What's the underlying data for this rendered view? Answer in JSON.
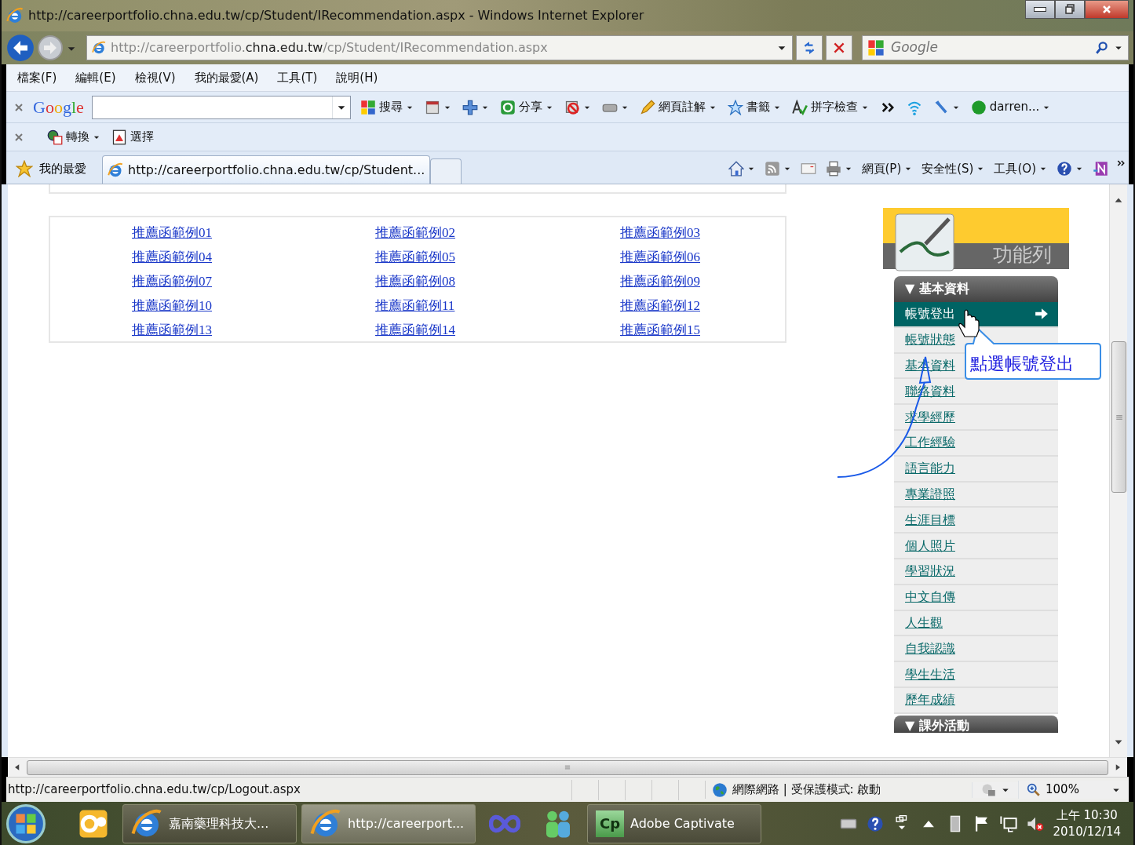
{
  "window": {
    "title": "http://careerportfolio.chna.edu.tw/cp/Student/IRecommendation.aspx - Windows Internet Explorer"
  },
  "address_bar": {
    "url_parts": [
      "http://careerportfolio.",
      "chna.edu.tw",
      "/cp/Student/IRecommendation.aspx"
    ],
    "search_placeholder": "Google"
  },
  "menu": [
    "檔案(F)",
    "編輯(E)",
    "檢視(V)",
    "我的最愛(A)",
    "工具(T)",
    "說明(H)"
  ],
  "google_toolbar": {
    "logo": "Google",
    "items": [
      {
        "kind": "gsearch",
        "label": "搜尋",
        "dropdown": true
      },
      {
        "kind": "page",
        "dropdown": true
      },
      {
        "kind": "plus",
        "dropdown": true
      },
      {
        "kind": "share",
        "label": "分享",
        "dropdown": true
      },
      {
        "kind": "blocker",
        "dropdown": true
      },
      {
        "kind": "box",
        "dropdown": true
      },
      {
        "kind": "note",
        "label": "網頁註解",
        "dropdown": true
      },
      {
        "kind": "star",
        "label": "書籤",
        "dropdown": true
      },
      {
        "kind": "spell",
        "label": "拼字檢查",
        "dropdown": true
      },
      {
        "kind": "more",
        "dropdown": false
      },
      {
        "kind": "wifi",
        "dropdown": false
      },
      {
        "kind": "wrench",
        "dropdown": true
      },
      {
        "kind": "user",
        "label": "darren...",
        "dropdown": true
      }
    ]
  },
  "convert_toolbar": [
    {
      "kind": "globepdf",
      "label": "轉換",
      "dropdown": true
    },
    {
      "kind": "pdfdoc",
      "label": "選擇",
      "dropdown": false
    }
  ],
  "tab_bar": {
    "favorites": "我的最愛",
    "tabs": [
      {
        "title": "http://careerportfolio.chna.edu.tw/cp/Student...",
        "selected": true
      }
    ],
    "commands": [
      {
        "kind": "home",
        "dropdown": true
      },
      {
        "kind": "feed",
        "dropdown": true
      },
      {
        "kind": "mail",
        "dropdown": false
      },
      {
        "kind": "print",
        "dropdown": true
      },
      {
        "kind": "menu",
        "label": "網頁(P)",
        "dropdown": true
      },
      {
        "kind": "menu",
        "label": "安全性(S)",
        "dropdown": true
      },
      {
        "kind": "menu",
        "label": "工具(O)",
        "dropdown": true
      },
      {
        "kind": "help",
        "dropdown": true
      },
      {
        "kind": "onenote",
        "dropdown": false
      }
    ]
  },
  "links": [
    "推薦函範例01",
    "推薦函範例02",
    "推薦函範例03",
    "推薦函範例04",
    "推薦函範例05",
    "推薦函範例06",
    "推薦函範例07",
    "推薦函範例08",
    "推薦函範例09",
    "推薦函範例10",
    "推薦函範例11",
    "推薦函範例12",
    "推薦函範例13",
    "推薦函範例14",
    "推薦函範例15"
  ],
  "sidebar": {
    "banner_title": "功能列",
    "sections": [
      {
        "title": "▼ 基本資料",
        "items": [
          {
            "label": "帳號登出",
            "selected": true
          },
          {
            "label": "帳號狀態",
            "selected": false
          },
          {
            "label": "基本資料",
            "selected": false
          },
          {
            "label": "聯絡資料",
            "selected": false
          },
          {
            "label": "求學經歷",
            "selected": false
          },
          {
            "label": "工作經驗",
            "selected": false
          },
          {
            "label": "語言能力",
            "selected": false
          },
          {
            "label": "專業證照",
            "selected": false
          },
          {
            "label": "生涯目標",
            "selected": false
          },
          {
            "label": "個人照片",
            "selected": false
          },
          {
            "label": "學習狀況",
            "selected": false
          },
          {
            "label": "中文自傳",
            "selected": false
          },
          {
            "label": "人生觀",
            "selected": false
          },
          {
            "label": "自我認識",
            "selected": false
          },
          {
            "label": "學生生活",
            "selected": false
          },
          {
            "label": "歷年成績",
            "selected": false
          }
        ]
      },
      {
        "title": "▼ 課外活動"
      }
    ]
  },
  "callout": {
    "text": "點選帳號登出"
  },
  "status_bar": {
    "url": "http://careerportfolio.chna.edu.tw/cp/Logout.aspx",
    "zone": "網際網路 | 受保護模式: 啟動",
    "zoom": "100%"
  },
  "taskbar": {
    "items": [
      {
        "kind": "outlook",
        "selected": false
      },
      {
        "kind": "ie",
        "label": "嘉南藥理科技大...",
        "selected": false
      },
      {
        "kind": "ie",
        "label": "http://careerport...",
        "selected": true
      },
      {
        "kind": "infinity",
        "selected": false
      },
      {
        "kind": "people",
        "selected": false
      },
      {
        "kind": "cp",
        "badge": "Cp",
        "label": "Adobe Captivate",
        "selected": false
      }
    ],
    "time": "上午 10:30",
    "date": "2010/12/14"
  }
}
